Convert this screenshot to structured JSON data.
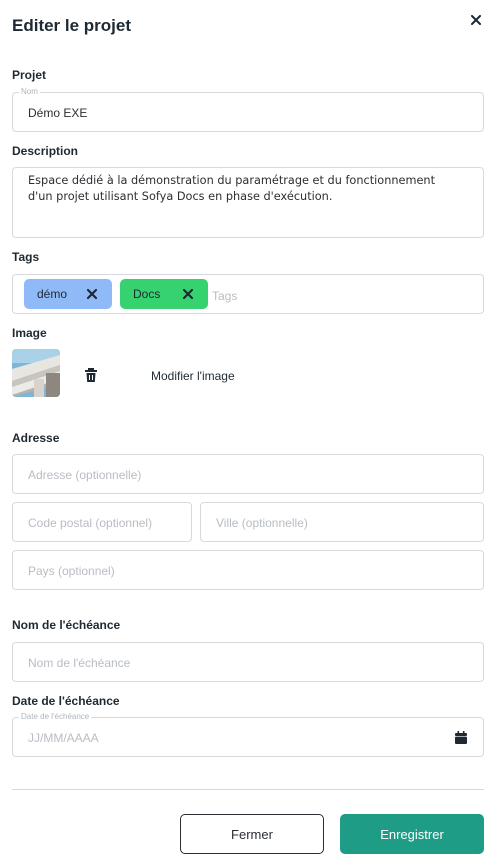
{
  "modal": {
    "title": "Editer le projet"
  },
  "projet": {
    "section_label": "Projet",
    "name_label": "Nom",
    "name_value": "Démo EXE"
  },
  "description": {
    "section_label": "Description",
    "value": "Espace dédié à la démonstration du paramétrage et du fonctionnement d'un projet utilisant Sofya Docs en phase d'exécution."
  },
  "tags": {
    "section_label": "Tags",
    "items": [
      {
        "label": "démo",
        "color": "#8fb9f7"
      },
      {
        "label": "Docs",
        "color": "#37d270"
      }
    ],
    "placeholder": "Tags"
  },
  "image": {
    "section_label": "Image",
    "modify_label": "Modifier l'image"
  },
  "adresse": {
    "section_label": "Adresse",
    "address_placeholder": "Adresse (optionnelle)",
    "postal_placeholder": "Code postal (optionnel)",
    "city_placeholder": "Ville (optionnelle)",
    "country_placeholder": "Pays (optionnel)"
  },
  "echeance_name": {
    "section_label": "Nom de l'échéance",
    "placeholder": "Nom de l'échéance"
  },
  "echeance_date": {
    "section_label": "Date de l'échéance",
    "float_label": "Date de l'échéance",
    "placeholder": "JJ/MM/AAAA"
  },
  "footer": {
    "close_label": "Fermer",
    "save_label": "Enregistrer"
  },
  "colors": {
    "accent": "#1f9c85",
    "border": "#d6d9dd"
  }
}
